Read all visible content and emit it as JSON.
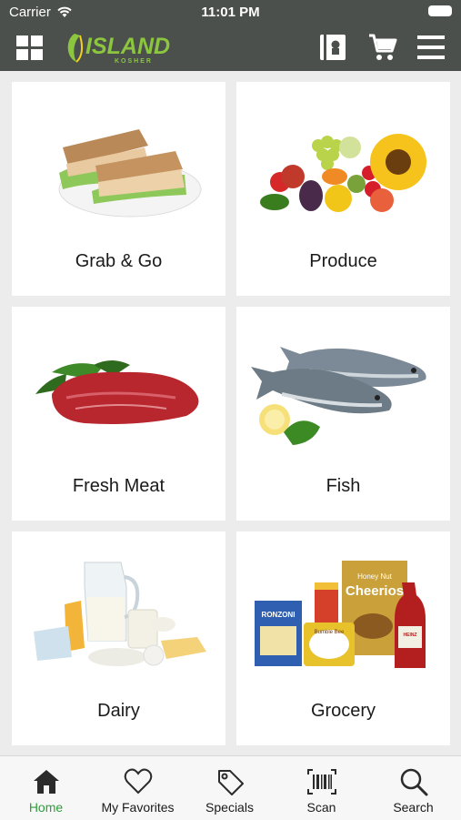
{
  "status_bar": {
    "carrier": "Carrier",
    "time": "11:01 PM"
  },
  "header": {
    "logo_text": "ISLAND",
    "logo_subtext": "KOSHER"
  },
  "categories": [
    {
      "label": "Grab & Go"
    },
    {
      "label": "Produce"
    },
    {
      "label": "Fresh Meat"
    },
    {
      "label": "Fish"
    },
    {
      "label": "Dairy"
    },
    {
      "label": "Grocery"
    }
  ],
  "grocery_items": {
    "pasta": "RONZONI",
    "cereal": "Cheerios",
    "cereal_top": "Honey Nut",
    "tuna": "Bumble Bee",
    "ketchup": "HEINZ"
  },
  "tabs": [
    {
      "label": "Home",
      "icon": "home-icon",
      "active": true
    },
    {
      "label": "My Favorites",
      "icon": "heart-icon",
      "active": false
    },
    {
      "label": "Specials",
      "icon": "tag-icon",
      "active": false
    },
    {
      "label": "Scan",
      "icon": "barcode-icon",
      "active": false
    },
    {
      "label": "Search",
      "icon": "search-icon",
      "active": false
    }
  ],
  "colors": {
    "header_bg": "#4b504c",
    "accent_green": "#2e9e3a",
    "logo_green": "#8cc63f",
    "page_bg": "#ececec"
  }
}
